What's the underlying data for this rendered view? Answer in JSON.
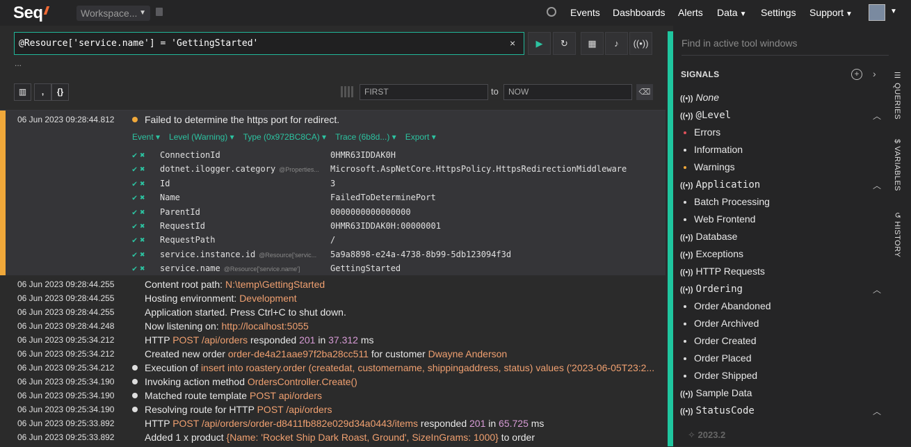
{
  "topbar": {
    "brand": "Seq",
    "workspace": "Workspace...",
    "nav": [
      "Events",
      "Dashboards",
      "Alerts",
      "Data",
      "Settings",
      "Support"
    ]
  },
  "query": {
    "text": "@Resource['service.name'] = 'GettingStarted'",
    "clear": "×",
    "more": "...",
    "range_from_placeholder": "FIRST",
    "range_to_label": "to",
    "range_to_placeholder": "NOW"
  },
  "expanded_event": {
    "timestamp": "06 Jun 2023  09:28:44.812",
    "message": "Failed to determine the https port for redirect.",
    "level_color": "#f0a83a",
    "actions": [
      "Event ▾",
      "Level (Warning) ▾",
      "Type (0x972BC8CA) ▾",
      "Trace (6b8d...) ▾",
      "Export ▾"
    ],
    "properties": [
      {
        "name": "ConnectionId",
        "path": "",
        "value": "0HMR63IDDAK0H"
      },
      {
        "name": "dotnet.ilogger.category",
        "path": "@Properties...",
        "value": "Microsoft.AspNetCore.HttpsPolicy.HttpsRedirectionMiddleware"
      },
      {
        "name": "Id",
        "path": "",
        "value": "3"
      },
      {
        "name": "Name",
        "path": "",
        "value": "FailedToDeterminePort"
      },
      {
        "name": "ParentId",
        "path": "",
        "value": "0000000000000000"
      },
      {
        "name": "RequestId",
        "path": "",
        "value": "0HMR63IDDAK0H:00000001"
      },
      {
        "name": "RequestPath",
        "path": "",
        "value": "/"
      },
      {
        "name": "service.instance.id",
        "path": "@Resource['servic...",
        "value": "5a9a8898-e24a-4738-8b99-5db123094f3d"
      },
      {
        "name": "service.name",
        "path": "@Resource['service.name']",
        "value": "GettingStarted"
      }
    ]
  },
  "events": [
    {
      "ts": "06 Jun 2023  09:28:44.255",
      "dot": "",
      "parts": [
        [
          "Content root path: ",
          ""
        ],
        [
          "N:\\temp\\GettingStarted",
          "hl"
        ]
      ]
    },
    {
      "ts": "06 Jun 2023  09:28:44.255",
      "dot": "",
      "parts": [
        [
          "Hosting environment: ",
          ""
        ],
        [
          "Development",
          "hl"
        ]
      ]
    },
    {
      "ts": "06 Jun 2023  09:28:44.255",
      "dot": "",
      "parts": [
        [
          "Application started. Press Ctrl+C to shut down.",
          ""
        ]
      ]
    },
    {
      "ts": "06 Jun 2023  09:28:44.248",
      "dot": "",
      "parts": [
        [
          "Now listening on: ",
          ""
        ],
        [
          "http://localhost:5055",
          "hl"
        ]
      ]
    },
    {
      "ts": "06 Jun 2023  09:25:34.212",
      "dot": "",
      "parts": [
        [
          "HTTP ",
          ""
        ],
        [
          "POST",
          "hl"
        ],
        [
          " ",
          ""
        ],
        [
          "/api/orders",
          "hl"
        ],
        [
          " responded ",
          ""
        ],
        [
          "201",
          "hl-num"
        ],
        [
          " in ",
          ""
        ],
        [
          "37.312",
          "hl-num"
        ],
        [
          " ms",
          ""
        ]
      ]
    },
    {
      "ts": "06 Jun 2023  09:25:34.212",
      "dot": "",
      "parts": [
        [
          "Created new order ",
          ""
        ],
        [
          "order-de4a21aae97f2ba28cc511",
          "hl"
        ],
        [
          " for customer ",
          ""
        ],
        [
          "Dwayne Anderson",
          "hl"
        ]
      ]
    },
    {
      "ts": "06 Jun 2023  09:25:34.212",
      "dot": "#dddddd",
      "parts": [
        [
          "Execution of ",
          ""
        ],
        [
          "insert into roastery.order (createdat, customername, shippingaddress, status) values ('2023-06-05T23:2...",
          "hl"
        ]
      ]
    },
    {
      "ts": "06 Jun 2023  09:25:34.190",
      "dot": "#dddddd",
      "parts": [
        [
          "Invoking action method ",
          ""
        ],
        [
          "OrdersController.Create()",
          "hl"
        ]
      ]
    },
    {
      "ts": "06 Jun 2023  09:25:34.190",
      "dot": "#dddddd",
      "parts": [
        [
          "Matched route template ",
          ""
        ],
        [
          "POST api/orders",
          "hl"
        ]
      ]
    },
    {
      "ts": "06 Jun 2023  09:25:34.190",
      "dot": "#dddddd",
      "parts": [
        [
          "Resolving route for HTTP ",
          ""
        ],
        [
          "POST",
          "hl"
        ],
        [
          " ",
          ""
        ],
        [
          "/api/orders",
          "hl"
        ]
      ]
    },
    {
      "ts": "06 Jun 2023  09:25:33.892",
      "dot": "",
      "parts": [
        [
          "HTTP ",
          ""
        ],
        [
          "POST",
          "hl"
        ],
        [
          " ",
          ""
        ],
        [
          "/api/orders/order-d8411fb882e029d34a0443/items",
          "hl"
        ],
        [
          " responded ",
          ""
        ],
        [
          "201",
          "hl-num"
        ],
        [
          " in ",
          ""
        ],
        [
          "65.725",
          "hl-num"
        ],
        [
          " ms",
          ""
        ]
      ]
    },
    {
      "ts": "06 Jun 2023  09:25:33.892",
      "dot": "",
      "parts": [
        [
          "Added 1 x product ",
          ""
        ],
        [
          "{Name: 'Rocket Ship Dark Roast, Ground', SizeInGrams: 1000}",
          "hl"
        ],
        [
          " to order",
          ""
        ]
      ]
    }
  ],
  "side": {
    "find_placeholder": "Find in active tool windows",
    "signals_heading": "SIGNALS",
    "signals": [
      {
        "label": "None",
        "kind": "top",
        "style": "italic"
      },
      {
        "label": "@Level",
        "kind": "group",
        "style": "mono"
      },
      {
        "label": "Errors",
        "kind": "sub",
        "dot": "#e0505a"
      },
      {
        "label": "Information",
        "kind": "sub",
        "dot": "#dddddd"
      },
      {
        "label": "Warnings",
        "kind": "sub",
        "dot": "#f0a83a"
      },
      {
        "label": "Application",
        "kind": "group",
        "style": "mono"
      },
      {
        "label": "Batch Processing",
        "kind": "sub",
        "dot": "#dddddd"
      },
      {
        "label": "Web Frontend",
        "kind": "sub",
        "dot": "#dddddd"
      },
      {
        "label": "Database",
        "kind": "top",
        "style": ""
      },
      {
        "label": "Exceptions",
        "kind": "top",
        "style": ""
      },
      {
        "label": "HTTP Requests",
        "kind": "top",
        "style": ""
      },
      {
        "label": "Ordering",
        "kind": "group",
        "style": "mono"
      },
      {
        "label": "Order Abandoned",
        "kind": "sub",
        "dot": "#dddddd"
      },
      {
        "label": "Order Archived",
        "kind": "sub",
        "dot": "#dddddd"
      },
      {
        "label": "Order Created",
        "kind": "sub",
        "dot": "#dddddd"
      },
      {
        "label": "Order Placed",
        "kind": "sub",
        "dot": "#dddddd"
      },
      {
        "label": "Order Shipped",
        "kind": "sub",
        "dot": "#dddddd"
      },
      {
        "label": "Sample Data",
        "kind": "top",
        "style": ""
      },
      {
        "label": "StatusCode",
        "kind": "group",
        "style": "mono"
      }
    ],
    "version": "2023.2",
    "tabs": [
      "QUERIES",
      "VARIABLES",
      "HISTORY"
    ]
  },
  "colors": {
    "accent": "#1fc69f",
    "warning": "#f0a83a",
    "highlight": "#f0a070",
    "number": "#d79bd6"
  }
}
